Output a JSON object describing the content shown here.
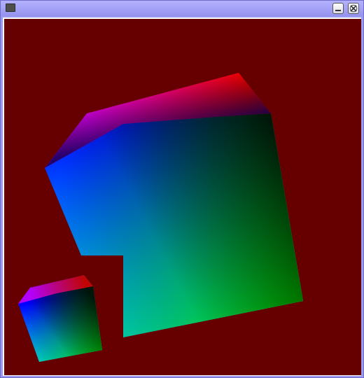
{
  "window": {
    "title": "",
    "icon": "app-window-icon",
    "buttons": [
      {
        "name": "minimize-button",
        "icon": "minimize-icon"
      },
      {
        "name": "close-button",
        "icon": "close-icon"
      }
    ]
  },
  "scene": {
    "background_color": "#660000",
    "objects": [
      {
        "name": "large-cube",
        "colors": [
          "#ff00ff",
          "#ff0000",
          "#000000",
          "#0000ff",
          "#00ff00",
          "#00ffff"
        ]
      },
      {
        "name": "small-cube",
        "colors": [
          "#ff00ff",
          "#ff0000",
          "#000000",
          "#0000ff",
          "#00ff00",
          "#00ffff"
        ]
      }
    ]
  }
}
